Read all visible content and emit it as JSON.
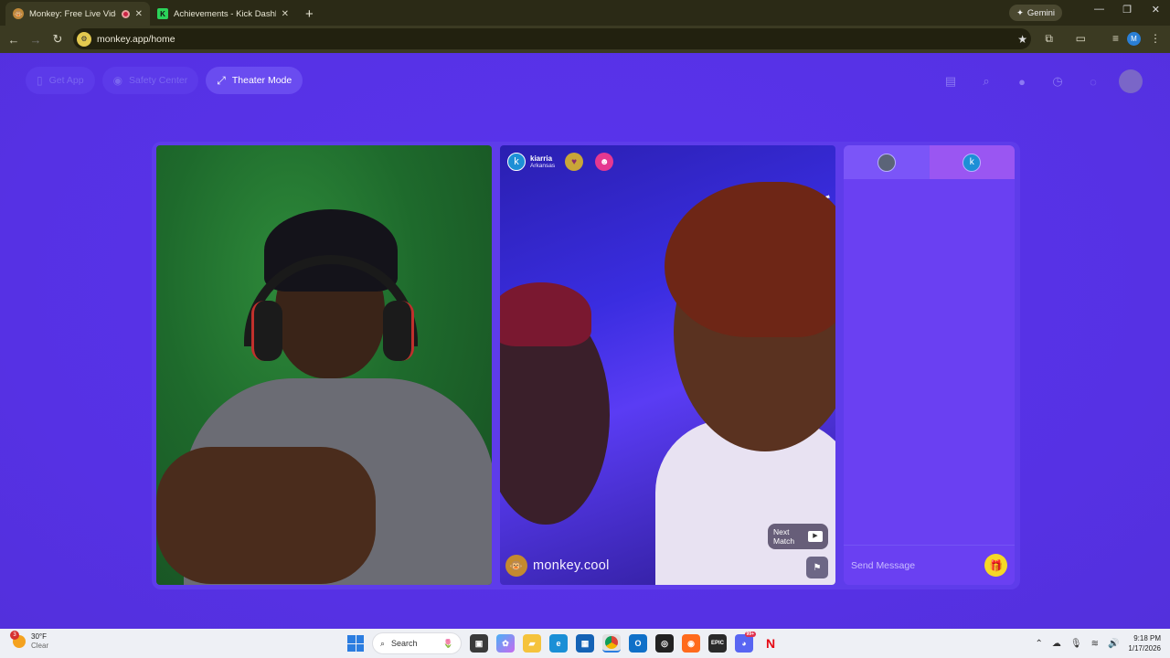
{
  "browser": {
    "tabs": [
      {
        "title": "Monkey: Free Live Video Ch",
        "active": true
      },
      {
        "title": "Achievements - Kick Dashboard",
        "active": false
      }
    ],
    "gemini_label": "Gemini",
    "url": "monkey.app/home",
    "profile_initial": "M"
  },
  "nav": {
    "get_app": "Get App",
    "safety_center": "Safety Center",
    "theater_mode": "Theater Mode"
  },
  "match": {
    "user_initial": "k",
    "username": "kiarria",
    "location": "Arkansas",
    "next_match_label": "Next Match",
    "watermark": "monkey.cool"
  },
  "chat": {
    "partner_initial": "k",
    "input_placeholder": "Send Message"
  },
  "taskbar": {
    "weather_temp": "30°F",
    "weather_desc": "Clear",
    "weather_badge": "3",
    "search_placeholder": "Search",
    "discord_badge": "99+",
    "time": "9:18 PM",
    "date": "1/17/2026"
  },
  "colors": {
    "page_bg": "#5b33e8",
    "accent": "#6a40f2",
    "gift": "#f5d826"
  }
}
